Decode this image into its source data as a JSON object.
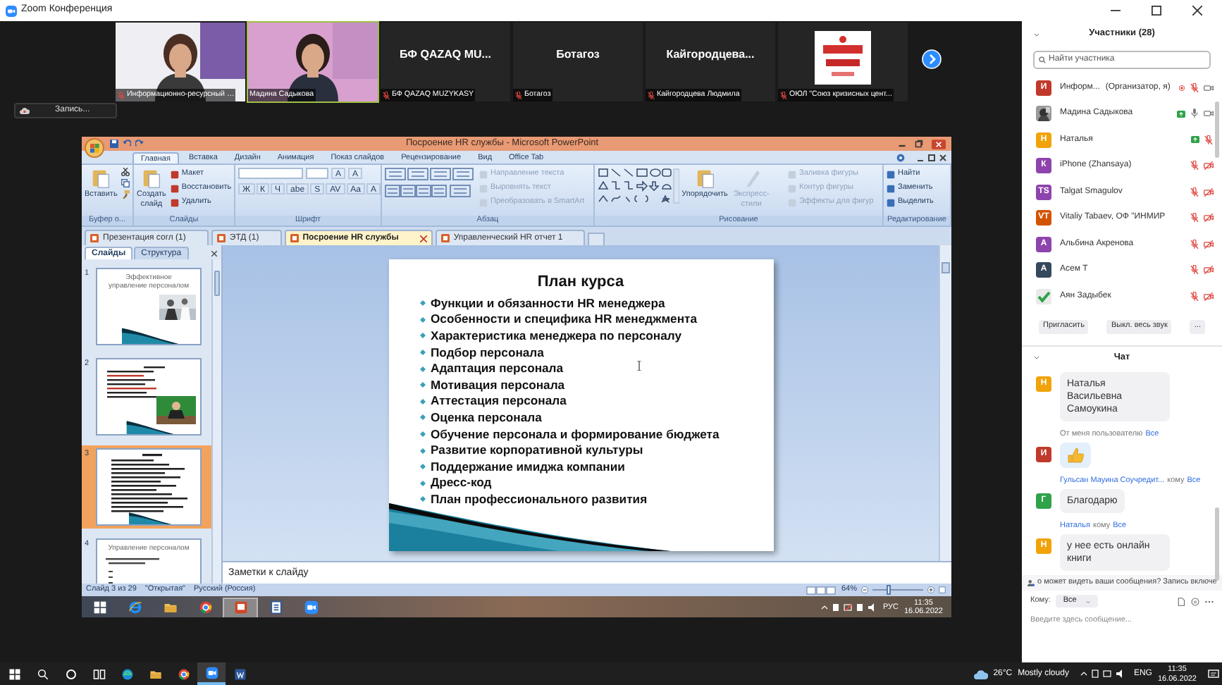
{
  "window": {
    "title": "Zoom Конференция"
  },
  "video_strip": {
    "tiles": [
      {
        "kind": "video",
        "label": "Информационно-ресурсный …",
        "muted": true,
        "active_speaker": false
      },
      {
        "kind": "video",
        "label": "Мадина Садыкова",
        "muted": false,
        "active_speaker": true
      },
      {
        "kind": "name",
        "title": "БФ QAZAQ MU...",
        "label": "БФ QAZAQ MUZYKASY",
        "muted": true,
        "active_speaker": false
      },
      {
        "kind": "name",
        "title": "Ботагоз",
        "label": "Ботагоз",
        "muted": true,
        "active_speaker": false
      },
      {
        "kind": "name",
        "title": "Кайгородцева...",
        "label": "Кайгородцева Людмила",
        "muted": true,
        "active_speaker": false
      },
      {
        "kind": "logo",
        "label": "ОЮЛ \"Союз кризисных цент...",
        "muted": true,
        "active_speaker": false
      }
    ]
  },
  "record_button": {
    "label": "Запись..."
  },
  "powerpoint": {
    "title": "Посроение HR службы - Microsoft PowerPoint",
    "ribbon_tabs": [
      {
        "label": "Главная",
        "selected": true
      },
      {
        "label": "Вставка",
        "selected": false
      },
      {
        "label": "Дизайн",
        "selected": false
      },
      {
        "label": "Анимация",
        "selected": false
      },
      {
        "label": "Показ слайдов",
        "selected": false
      },
      {
        "label": "Рецензирование",
        "selected": false
      },
      {
        "label": "Вид",
        "selected": false
      },
      {
        "label": "Office Tab",
        "selected": false
      }
    ],
    "ribbon_groups": [
      {
        "kind": "clipboard",
        "title": "Буфер о...",
        "buttons": [
          {
            "label": "Вставить",
            "disabled": false
          }
        ]
      },
      {
        "kind": "slides",
        "title": "Слайды",
        "buttons": [
          {
            "label": "Создать слайд",
            "disabled": false
          },
          {
            "label": "Макет",
            "disabled": false
          },
          {
            "label": "Восстановить",
            "disabled": false
          },
          {
            "label": "Удалить",
            "disabled": false
          }
        ]
      },
      {
        "kind": "font",
        "title": "Шрифт",
        "top_glyphs": [
          "A",
          "A"
        ],
        "glyphs": [
          "Ж",
          "К",
          "Ч",
          "abe",
          "S",
          "AV",
          "Aa",
          "A"
        ]
      },
      {
        "kind": "paragraph",
        "title": "Абзац",
        "buttons": [
          {
            "label": "Направление текста",
            "disabled": true
          },
          {
            "label": "Выровнять текст",
            "disabled": true
          },
          {
            "label": "Преобразовать в SmartArt",
            "disabled": true
          }
        ]
      },
      {
        "kind": "drawing",
        "title": "Рисование",
        "buttons": [
          {
            "label": "Упорядочить",
            "disabled": false
          },
          {
            "label": "Экспресс-стили",
            "disabled": true
          },
          {
            "label": "Заливка фигуры",
            "disabled": true
          },
          {
            "label": "Контур фигуры",
            "disabled": true
          },
          {
            "label": "Эффекты для фигур",
            "disabled": true
          }
        ]
      },
      {
        "kind": "editing",
        "title": "Редактирование",
        "buttons": [
          {
            "label": "Найти",
            "disabled": false
          },
          {
            "label": "Заменить",
            "disabled": false
          },
          {
            "label": "Выделить",
            "disabled": false
          }
        ]
      }
    ],
    "document_tabs": [
      {
        "label": "Презентация согл (1)",
        "selected": false
      },
      {
        "label": "ЭТД (1)",
        "selected": false
      },
      {
        "label": "Посроение HR службы",
        "selected": true
      },
      {
        "label": "Управленческий HR отчет 1",
        "selected": false
      }
    ],
    "pane_tabs": [
      {
        "label": "Слайды",
        "selected": true
      },
      {
        "label": "Структура",
        "selected": false
      }
    ],
    "thumbnails": [
      {
        "number": "1",
        "kind": "title_photo",
        "title": "Эффективное управление персоналом",
        "selected": false
      },
      {
        "number": "2",
        "kind": "text_photo",
        "selected": false
      },
      {
        "number": "3",
        "kind": "list",
        "selected": true
      },
      {
        "number": "4",
        "kind": "title_list",
        "title": "Управление персоналом",
        "selected": false
      }
    ],
    "slide": {
      "title": "План курса",
      "bullets": [
        "Функции и обязанности HR менеджера",
        "Особенности и специфика HR менеджмента",
        "Характеристика менеджера по персоналу",
        "Подбор персонала",
        "Адаптация персонала",
        "Мотивация персонала",
        "Аттестация персонала",
        "Оценка персонала",
        "Обучение персонала и формирование бюджета",
        "Развитие корпоративной культуры",
        "Поддержание имиджа компании",
        "Дресс-код",
        "План профессионального развития"
      ]
    },
    "notes_placeholder": "Заметки к слайду",
    "status_bar": {
      "items": [
        "Слайд 3 из 29",
        "\"Открытая\"",
        "Русский (Россия)"
      ],
      "zoom": {
        "reading": "64%",
        "level": 0.3
      }
    },
    "taskbar": {
      "apps": [
        {
          "kind": "start",
          "active": false
        },
        {
          "kind": "ie",
          "active": false
        },
        {
          "kind": "folder",
          "active": false
        },
        {
          "kind": "chrome",
          "active": false
        },
        {
          "kind": "powerpoint",
          "active": true
        },
        {
          "kind": "document",
          "active": false
        },
        {
          "kind": "zoom",
          "active": false
        }
      ],
      "language": "РУС",
      "time": "11:35",
      "date": "16.06.2022"
    }
  },
  "participants": {
    "title": "Участники (28)",
    "search_placeholder": "Найти участника",
    "items": [
      {
        "kind": "initials",
        "initial": "И",
        "color": "#c0392b",
        "name": "Информ...",
        "role": "(Организатор, я)",
        "recording": true,
        "sharing": false,
        "muted": true,
        "camera_shown": true,
        "video_off": false
      },
      {
        "name": "Мадина Садыкова",
        "recording": false,
        "sharing": true,
        "muted": false,
        "camera_shown": true,
        "video_off": false
      },
      {
        "kind": "initials",
        "initial": "Н",
        "color": "#f0a30a",
        "name": "Наталья",
        "recording": false,
        "sharing": true,
        "muted": true,
        "camera_shown": false
      },
      {
        "kind": "initials",
        "initial": "К",
        "color": "#8e44ad",
        "name": "iPhone (Zhansaya)",
        "recording": false,
        "sharing": false,
        "muted": true,
        "camera_shown": true,
        "video_off": true
      },
      {
        "kind": "initials",
        "initial": "TS",
        "color": "#8e44ad",
        "name": "Talgat Smagulov",
        "recording": false,
        "sharing": false,
        "muted": true,
        "camera_shown": true,
        "video_off": true
      },
      {
        "kind": "initials",
        "initial": "VT",
        "color": "#d35400",
        "name": "Vitaliy Tabaev, ОФ \"ИНМИР",
        "recording": false,
        "sharing": false,
        "muted": true,
        "camera_shown": true,
        "video_off": true
      },
      {
        "kind": "initials",
        "initial": "А",
        "color": "#8e44ad",
        "name": "Альбина Акренова",
        "recording": false,
        "sharing": false,
        "muted": true,
        "camera_shown": true,
        "video_off": true
      },
      {
        "kind": "initials",
        "initial": "А",
        "color": "#34495e",
        "name": "Асем Т",
        "recording": false,
        "sharing": false,
        "muted": true,
        "camera_shown": true,
        "video_off": true
      },
      {
        "kind": "check",
        "name": "Аян Задыбек",
        "recording": false,
        "sharing": false,
        "muted": true,
        "camera_shown": true,
        "video_off": true
      }
    ],
    "buttons": [
      "Пригласить",
      "Выкл. весь звук",
      "..."
    ]
  },
  "chat": {
    "title": "Чат",
    "items": [
      {
        "kind": "message",
        "initial": "Н",
        "color": "#f0a30a",
        "text": "Наталья Васильевна Самоукина"
      },
      {
        "kind": "meta",
        "parts": [
          {
            "text": "От меня пользователю",
            "link": false
          },
          {
            "text": "Все",
            "link": true
          }
        ]
      },
      {
        "kind": "emoji",
        "initial": "И",
        "color": "#c0392b"
      },
      {
        "kind": "meta",
        "parts": [
          {
            "text": "Гульсан Мауина Соучредит...",
            "link": true
          },
          {
            "text": "кому",
            "link": false
          },
          {
            "text": "Все",
            "link": true
          }
        ]
      },
      {
        "kind": "message",
        "initial": "Г",
        "color": "#2fa24a",
        "text": "Благодарю"
      },
      {
        "kind": "meta",
        "parts": [
          {
            "text": "Наталья",
            "link": true
          },
          {
            "text": "кому",
            "link": false
          },
          {
            "text": "Все",
            "link": true
          }
        ]
      },
      {
        "kind": "message",
        "initial": "Н",
        "color": "#f0a30a",
        "text": "у нее есть онлайн книги"
      }
    ],
    "notice": "о может видеть ваши сообщения? Запись включе",
    "to_label": "Кому:",
    "to_value": "Все",
    "input_placeholder": "Введите здесь сообщение..."
  },
  "taskbar": {
    "apps": [
      {
        "kind": "start",
        "active": false
      },
      {
        "kind": "search",
        "active": false
      },
      {
        "kind": "cortana",
        "active": false
      },
      {
        "kind": "taskview",
        "active": false
      },
      {
        "kind": "edge",
        "active": false
      },
      {
        "kind": "folder",
        "active": false
      },
      {
        "kind": "chrome",
        "active": false
      },
      {
        "kind": "zoom",
        "active": true
      },
      {
        "kind": "word",
        "active": false
      }
    ],
    "temperature": "26°C",
    "weather": "Mostly cloudy",
    "language": "ENG",
    "time": "11:35",
    "date": "16.06.2022"
  }
}
